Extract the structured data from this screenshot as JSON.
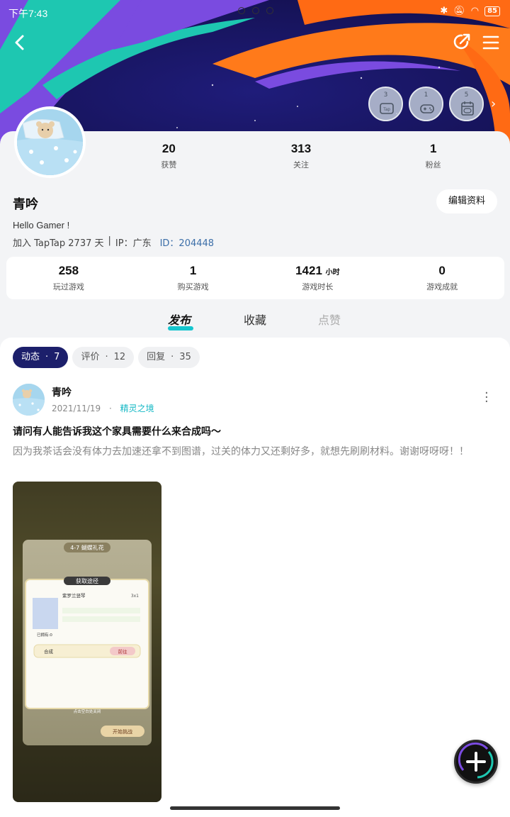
{
  "status_bar": {
    "time": "下午7:43",
    "battery": "85"
  },
  "stats_top": [
    {
      "value": "20",
      "label": "获赞"
    },
    {
      "value": "313",
      "label": "关注"
    },
    {
      "value": "1",
      "label": "粉丝"
    }
  ],
  "badges": [
    {
      "num": "3",
      "icon": "tap-icon"
    },
    {
      "num": "1",
      "icon": "gamepad-icon"
    },
    {
      "num": "5",
      "icon": "calendar-gamepad-icon"
    }
  ],
  "profile": {
    "name": "青吟",
    "edit_label": "编辑资料",
    "bio": "Hello Gamer !",
    "joined": "加入 TapTap 2737 天",
    "ip": "IP：广东",
    "id": "ID：204448"
  },
  "stats_box": [
    {
      "value": "258",
      "unit": "",
      "label": "玩过游戏"
    },
    {
      "value": "1",
      "unit": "",
      "label": "购买游戏"
    },
    {
      "value": "1421",
      "unit": "小时",
      "label": "游戏时长"
    },
    {
      "value": "0",
      "unit": "",
      "label": "游戏成就"
    }
  ],
  "tabs": {
    "t1": "发布",
    "t2": "收藏",
    "t3": "点赞"
  },
  "filters": [
    {
      "label": "动态",
      "count": "7"
    },
    {
      "label": "评价",
      "count": "12"
    },
    {
      "label": "回复",
      "count": "35"
    }
  ],
  "post": {
    "author": "青吟",
    "date": "2021/11/19",
    "group": "精灵之境",
    "title": "请问有人能告诉我这个家具需要什么来合成吗～",
    "body": "因为我茶话会没有体力去加速还拿不到图谱，过关的体力又还剩好多，就想先刷刷材料。谢谢呀呀呀！！",
    "image": {
      "stage": "4-7 蝴蝶礼花",
      "popup_title": "获取途径",
      "item_name": "紫罗兰竖琴",
      "item_count": "3x1",
      "owned": "已拥有:0",
      "source": "合成",
      "go": "前往",
      "start": "开始挑战",
      "close_hint": "点击空白处关闭"
    }
  }
}
